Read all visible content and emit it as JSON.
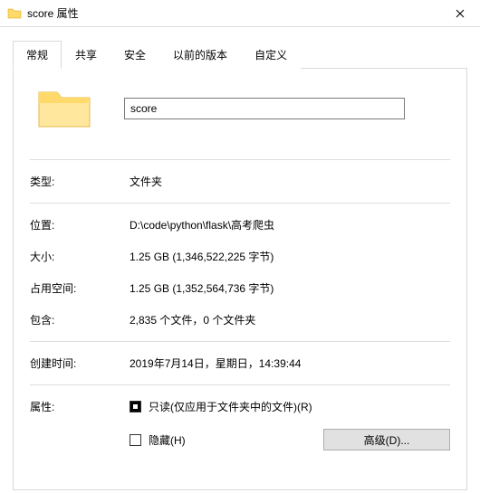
{
  "titlebar": {
    "title": "score 属性",
    "close_tooltip": "关闭"
  },
  "tabs": {
    "general": "常规",
    "sharing": "共享",
    "security": "安全",
    "previous": "以前的版本",
    "customize": "自定义",
    "active": "general"
  },
  "folder": {
    "name": "score"
  },
  "props": {
    "type_label": "类型:",
    "type_value": "文件夹",
    "location_label": "位置:",
    "location_value": "D:\\code\\python\\flask\\高考爬虫",
    "size_label": "大小:",
    "size_value": "1.25 GB (1,346,522,225 字节)",
    "sizeondisk_label": "占用空间:",
    "sizeondisk_value": "1.25 GB (1,352,564,736 字节)",
    "contains_label": "包含:",
    "contains_value": "2,835 个文件，0 个文件夹",
    "created_label": "创建时间:",
    "created_value": "2019年7月14日，星期日，14:39:44"
  },
  "attrs": {
    "label": "属性:",
    "readonly_label": "只读(仅应用于文件夹中的文件)(R)",
    "readonly_checked": true,
    "hidden_label": "隐藏(H)",
    "hidden_checked": false,
    "advanced_label": "高级(D)..."
  }
}
